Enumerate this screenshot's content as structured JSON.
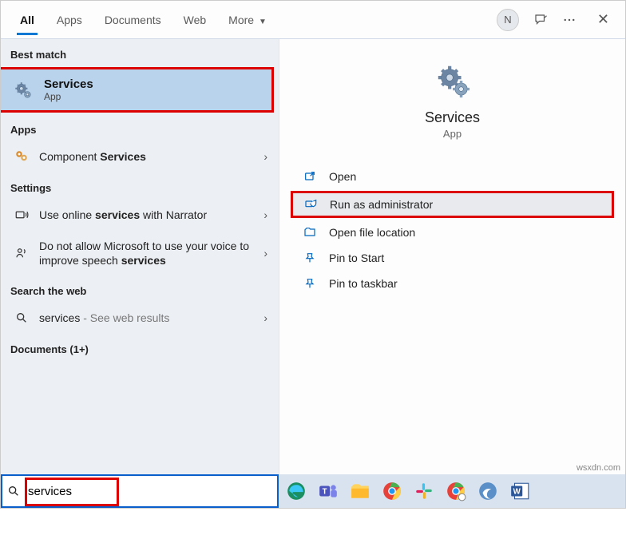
{
  "header": {
    "tabs": [
      "All",
      "Apps",
      "Documents",
      "Web",
      "More"
    ],
    "avatar_initial": "N"
  },
  "left": {
    "best_match_label": "Best match",
    "best_match": {
      "title": "Services",
      "subtitle": "App"
    },
    "apps_label": "Apps",
    "apps_item_prefix": "Component ",
    "apps_item_bold": "Services",
    "settings_label": "Settings",
    "setting1_prefix": "Use online ",
    "setting1_bold": "services",
    "setting1_suffix": " with Narrator",
    "setting2_prefix": "Do not allow Microsoft to use your voice to improve speech ",
    "setting2_bold": "services",
    "web_label": "Search the web",
    "web_prefix": "services",
    "web_suffix": " - See web results",
    "documents_label": "Documents (1+)"
  },
  "right": {
    "title": "Services",
    "subtitle": "App",
    "actions": {
      "open": "Open",
      "run_admin": "Run as administrator",
      "open_loc": "Open file location",
      "pin_start": "Pin to Start",
      "pin_taskbar": "Pin to taskbar"
    }
  },
  "search": {
    "value": "services"
  },
  "watermark": "wsxdn.com"
}
